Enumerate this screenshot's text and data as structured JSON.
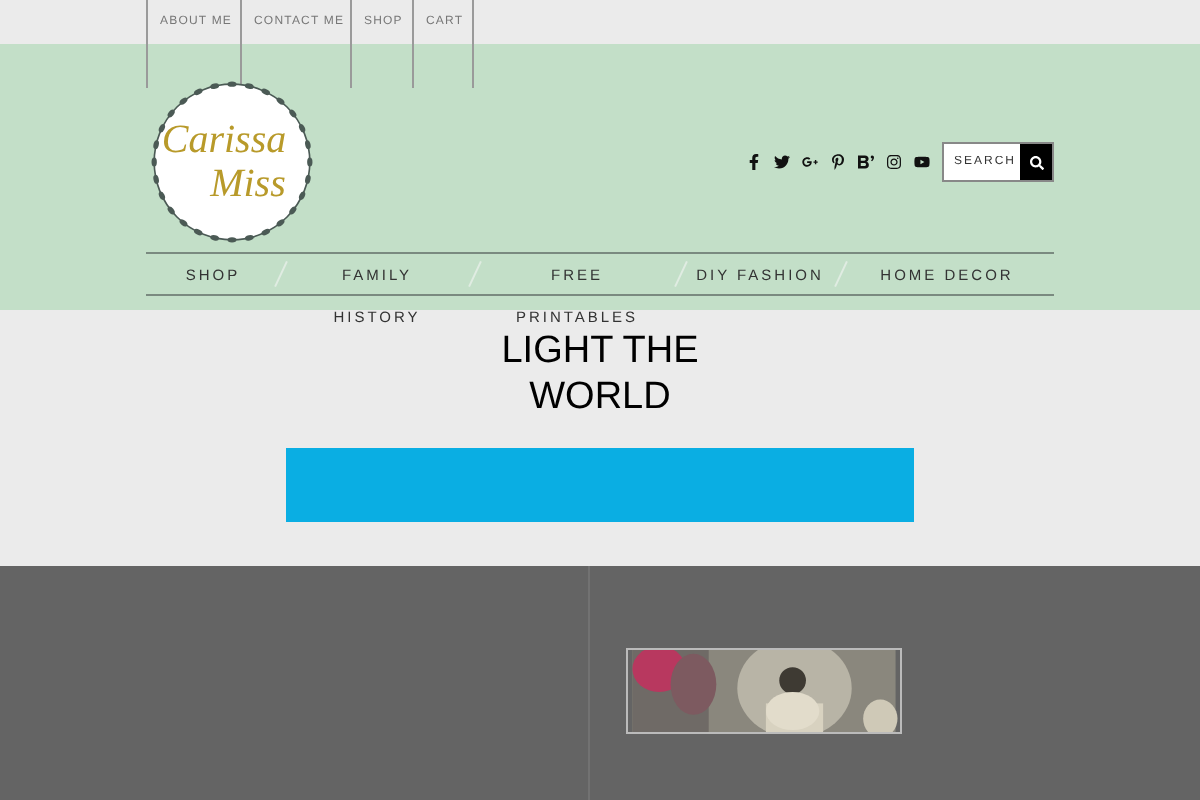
{
  "top_nav": [
    {
      "label": "ABOUT ME"
    },
    {
      "label": "CONTACT ME"
    },
    {
      "label": "SHOP"
    },
    {
      "label": "CART"
    }
  ],
  "logo": {
    "line1": "Carissa",
    "line2": "Miss"
  },
  "social": [
    {
      "kind": "facebook"
    },
    {
      "kind": "twitter"
    },
    {
      "kind": "googleplus"
    },
    {
      "kind": "pinterest"
    },
    {
      "kind": "bloglovin"
    },
    {
      "kind": "instagram"
    },
    {
      "kind": "youtube"
    }
  ],
  "search": {
    "placeholder": "SEARCH"
  },
  "main_nav": [
    {
      "label": "SHOP"
    },
    {
      "label": "FAMILY HISTORY"
    },
    {
      "label": "FREE PRINTABLES"
    },
    {
      "label": "DIY FASHION"
    },
    {
      "label": "HOME DECOR"
    }
  ],
  "heading": "LIGHT THE WORLD"
}
